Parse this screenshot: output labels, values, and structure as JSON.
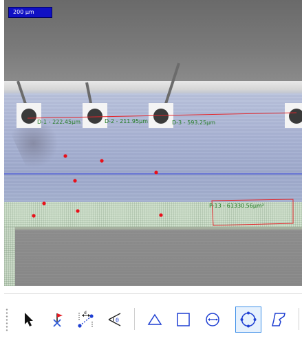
{
  "scale_bar": {
    "label": "200 µm"
  },
  "measurements": {
    "d1": "D-1 - 222.45µm",
    "d2": "D-2 - 211.95µm",
    "d3": "D-3 - 593.25µm",
    "area": "P-13 - 61330.56µm²"
  },
  "colors": {
    "measure_line": "#e3262b",
    "guide_line": "#3040d8",
    "marker": "#e8101a",
    "label_text": "#1f7a1f",
    "active_tool_border": "#3c8ee8"
  },
  "toolbar": {
    "active_tool": "ellipse-tool",
    "tools": [
      {
        "id": "select-tool",
        "icon": "arrow-cursor-icon"
      },
      {
        "id": "point-tool",
        "icon": "flag-point-icon"
      },
      {
        "id": "distance-tool",
        "icon": "distance-measure-icon"
      },
      {
        "id": "angle-tool",
        "icon": "angle-measure-icon"
      },
      {
        "id": "triangle-tool",
        "icon": "triangle-icon"
      },
      {
        "id": "rectangle-tool",
        "icon": "rectangle-icon"
      },
      {
        "id": "circle-tool",
        "icon": "circle-radius-icon"
      },
      {
        "id": "ellipse-tool",
        "icon": "circle-4point-icon"
      },
      {
        "id": "polygon-tool",
        "icon": "polygon-icon"
      }
    ]
  }
}
